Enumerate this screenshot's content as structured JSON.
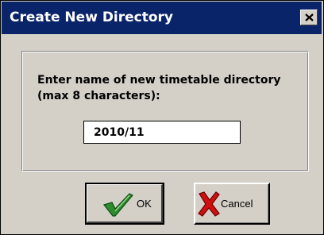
{
  "dialog": {
    "title": "Create New Directory",
    "close_icon": "close-icon",
    "prompt_line1": "Enter name of new timetable directory",
    "prompt_line2": "(max 8 characters):",
    "directory_input": {
      "value": "2010/11",
      "placeholder": ""
    },
    "buttons": {
      "ok_label": "OK",
      "ok_icon": "checkmark-icon",
      "cancel_label": "Cancel",
      "cancel_icon": "red-x-icon"
    }
  },
  "colors": {
    "titlebar": "#0a246a",
    "face": "#d4d0c8",
    "checkmark": "#2e8b2e",
    "cancel_x": "#d01010"
  }
}
